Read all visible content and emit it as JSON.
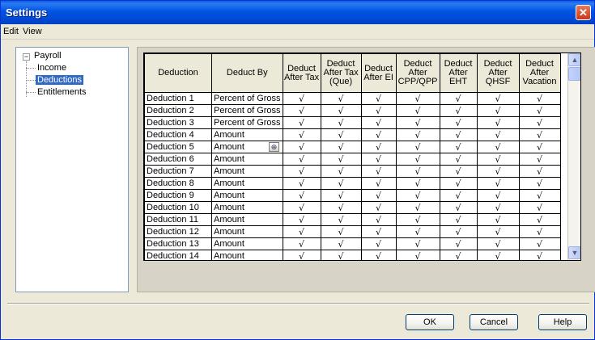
{
  "window": {
    "title": "Settings",
    "close_glyph": "✕"
  },
  "menu": [
    "Edit",
    "View"
  ],
  "tree": {
    "root": "Payroll",
    "expander": "−",
    "children": [
      "Income",
      "Deductions",
      "Entitlements"
    ],
    "selected": "Deductions"
  },
  "grid": {
    "headers": [
      "Deduction",
      "Deduct By",
      "Deduct After Tax",
      "Deduct After Tax (Que)",
      "Deduct After EI",
      "Deduct After CPP/QPP",
      "Deduct After EHT",
      "Deduct After QHSF",
      "Deduct After Vacation"
    ],
    "check_glyph": "√",
    "rows": [
      {
        "name": "Deduction 1",
        "by": "Percent of Gross"
      },
      {
        "name": "Deduction 2",
        "by": "Percent of Gross"
      },
      {
        "name": "Deduction 3",
        "by": "Percent of Gross"
      },
      {
        "name": "Deduction 4",
        "by": "Amount"
      },
      {
        "name": "Deduction 5",
        "by": "Amount"
      },
      {
        "name": "Deduction 6",
        "by": "Amount"
      },
      {
        "name": "Deduction 7",
        "by": "Amount"
      },
      {
        "name": "Deduction 8",
        "by": "Amount"
      },
      {
        "name": "Deduction 9",
        "by": "Amount"
      },
      {
        "name": "Deduction 10",
        "by": "Amount"
      },
      {
        "name": "Deduction 11",
        "by": "Amount"
      },
      {
        "name": "Deduction 12",
        "by": "Amount"
      },
      {
        "name": "Deduction 13",
        "by": "Amount"
      },
      {
        "name": "Deduction 14",
        "by": "Amount"
      }
    ],
    "zoom_icon": "search-icon",
    "scroll_up_glyph": "▲",
    "scroll_down_glyph": "▼"
  },
  "buttons": {
    "ok": "OK",
    "cancel": "Cancel",
    "help": "Help"
  },
  "colors": {
    "title_bar": "#0054e3",
    "selection": "#316ac5",
    "close_button": "#c8381a"
  }
}
